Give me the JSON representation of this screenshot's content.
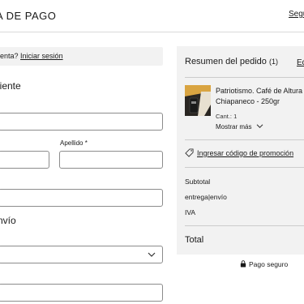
{
  "header": {
    "title": "A DE PAGO",
    "right_link": "Segu"
  },
  "login": {
    "prompt": "enta?",
    "link": "Iniciar sesión"
  },
  "customer": {
    "section_title": "liente",
    "last_name_label": "Apellido *"
  },
  "shipping": {
    "section_title": "nvío"
  },
  "summary": {
    "title": "Resumen del pedido",
    "count": "(1)",
    "edit": "Ed",
    "product": {
      "name": "Patriotismo. Café de Altura Chiapaneco - 250gr",
      "qty": "Cant.: 1",
      "more": "Mostrar más"
    },
    "promo": "Ingresar código de promoción",
    "rows": {
      "subtotal": "Subtotal",
      "delivery": "entrega|envío",
      "tax": "IVA"
    },
    "total": "Total"
  },
  "secure_label": "Pago seguro",
  "icons": {
    "tag": "tag-icon",
    "chevron": "chevron-down-icon",
    "lock": "lock-icon"
  }
}
